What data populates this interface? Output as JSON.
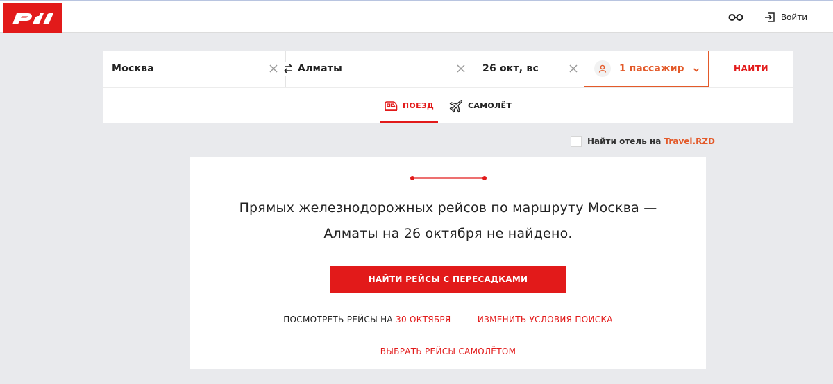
{
  "header": {
    "logo_text": "РЖД",
    "accessibility_icon": "glasses-icon",
    "login_label": "Войти",
    "login_icon": "login-icon"
  },
  "search": {
    "from": "Москва",
    "to": "Алматы",
    "date": "26 окт, вс",
    "passengers": "1 пассажир",
    "find_button": "НАЙТИ"
  },
  "modes": {
    "train": "ПОЕЗД",
    "plane": "САМОЛЁТ",
    "active": "train"
  },
  "hotel": {
    "label": "Найти отель на",
    "link": "Travel.RZD",
    "checked": false
  },
  "result": {
    "message_line1": "Прямых железнодорожных рейсов по маршруту Москва —",
    "message_line2": "Алматы на 26 октября не найдено.",
    "transfers_button": "НАЙТИ РЕЙСЫ С ПЕРЕСАДКАМИ",
    "see_on_prefix": "ПОСМОТРЕТЬ РЕЙСЫ НА",
    "see_on_date": "30 ОКТЯБРЯ",
    "change_search": "ИЗМЕНИТЬ УСЛОВИЯ ПОИСКА",
    "choose_plane": "ВЫБРАТЬ РЕЙСЫ САМОЛЁТОМ"
  },
  "colors": {
    "brand_red": "#e21a1a",
    "accent_orange": "#e35a2a",
    "background": "#e9eaed"
  }
}
